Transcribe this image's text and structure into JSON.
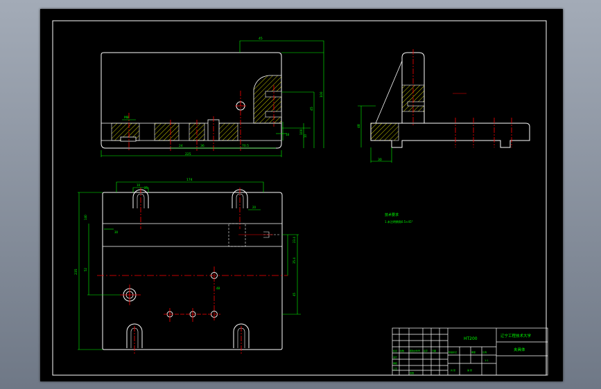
{
  "colors": {
    "background": "#000000",
    "outline": "#ffffff",
    "dimension": "#00ff00",
    "centerline": "#ff0000",
    "hatch": "#ffff00",
    "page": "#8b93a0"
  },
  "front_view": {
    "dims": [
      "45",
      "100",
      "45",
      "100",
      "36",
      "70.5",
      "225",
      "24",
      "M8",
      "18",
      "10"
    ]
  },
  "side_view": {
    "dims": [
      "48",
      "30"
    ]
  },
  "plan_view": {
    "dims": [
      "174",
      "10",
      "25",
      "30",
      "20",
      "235",
      "140",
      "52",
      "23.4",
      "35.4",
      "45",
      "48"
    ]
  },
  "notes": {
    "title": "技术要求",
    "line1": "1.未注明倒角0.5×45°"
  },
  "title_block": {
    "model": "HT200",
    "school": "辽宁工程技术大学",
    "name": "夹具体",
    "small": [
      "标记",
      "处数",
      "更改文件号",
      "签字",
      "日期",
      "设计",
      "审核",
      "工艺",
      "批准",
      "阶段标记",
      "重量",
      "比例",
      "1:1",
      "共 张",
      "第 张"
    ]
  }
}
